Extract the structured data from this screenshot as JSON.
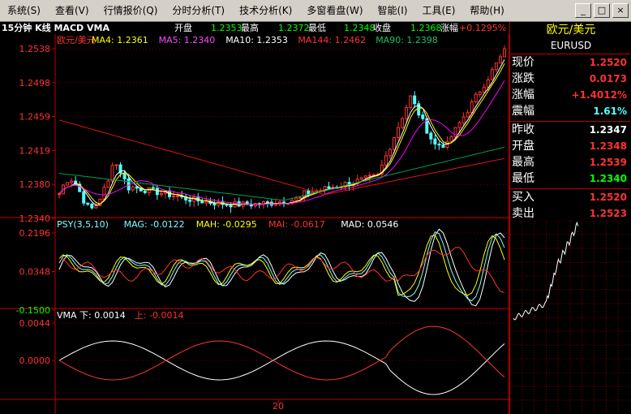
{
  "menu": [
    "系统(S)",
    "查看(V)",
    "行情报价(Q)",
    "分时分析(T)",
    "技术分析(K)",
    "多窗看盘(W)",
    "智能(I)",
    "工具(E)",
    "帮助(H)"
  ],
  "window_buttons": [
    "_",
    "□",
    "×"
  ],
  "header": {
    "period_label": "15分钟 K线 MACD VMA",
    "open_label": "开盘",
    "open_value": "1.2353",
    "high_label": "最高",
    "high_value": "1.2372",
    "low_label": "最低",
    "low_value": "1.2348",
    "close_label": "收盘",
    "close_value": "1.2368",
    "change_label": "涨幅",
    "change_value": "+0.1295%"
  },
  "colors": {
    "up": "#ff3232",
    "down": "#54ffff",
    "axis": "#c00000",
    "ma4": "#ffffff",
    "ma5": "#ffff00",
    "ma10": "#ff00ff",
    "ma144": "#dc1414",
    "ma90": "#00a050"
  },
  "price_panel": {
    "legend": [
      {
        "text": "欧元/美元",
        "color": "#ff3232"
      },
      {
        "text": "MA4: 1.2361",
        "color": "#ffff00"
      },
      {
        "text": "MA5: 1.2340",
        "color": "#ff44ff"
      },
      {
        "text": "MA10: 1.2353",
        "color": "#ffffff"
      },
      {
        "text": "MA144: 1.2462",
        "color": "#ff3232"
      },
      {
        "text": "MA90: 1.2398",
        "color": "#20c060"
      }
    ],
    "y_ticks": [
      "1.2538",
      "1.2498",
      "1.2459",
      "1.2419",
      "1.2380",
      "1.2340"
    ]
  },
  "psy_panel": {
    "legend": [
      {
        "text": "PSY(3,5,10)",
        "color": "#7fffff"
      },
      {
        "text": "MAG: -0.0122",
        "color": "#7fffff"
      },
      {
        "text": "MAH: -0.0295",
        "color": "#ffff00"
      },
      {
        "text": "MAI: -0.0617",
        "color": "#ff3232"
      },
      {
        "text": "MAD: 0.0546",
        "color": "#ffffff"
      }
    ],
    "y_ticks": [
      "0.2196",
      "0.0348",
      "-0.1500"
    ]
  },
  "vma_panel": {
    "legend": [
      {
        "text": "VMA 下: 0.0014",
        "color": "#ffffff"
      },
      {
        "text": "上: -0.0014",
        "color": "#ff3232"
      }
    ],
    "y_ticks": [
      "0.0044",
      "0.0000"
    ]
  },
  "x_axis": {
    "label": "20"
  },
  "side": {
    "name": "欧元/美元",
    "code": "EURUSD",
    "rows": [
      {
        "label": "现价",
        "value": "1.2520",
        "color": "#ff3232"
      },
      {
        "label": "涨跌",
        "value": "0.0173",
        "color": "#ff3232"
      },
      {
        "label": "涨幅",
        "value": "+1.4012%",
        "color": "#ff3232"
      },
      {
        "label": "震幅",
        "value": "1.61%",
        "color": "#54ffff"
      },
      {
        "label": "昨收",
        "value": "1.2347",
        "color": "#ffffff"
      },
      {
        "label": "开盘",
        "value": "1.2348",
        "color": "#ff3232"
      },
      {
        "label": "最高",
        "value": "1.2539",
        "color": "#ff3232"
      },
      {
        "label": "最低",
        "value": "1.2340",
        "color": "#00ff00"
      },
      {
        "label": "买入",
        "value": "1.2520",
        "color": "#ff3232"
      },
      {
        "label": "卖出",
        "value": "1.2523",
        "color": "#ff3232"
      }
    ]
  }
}
